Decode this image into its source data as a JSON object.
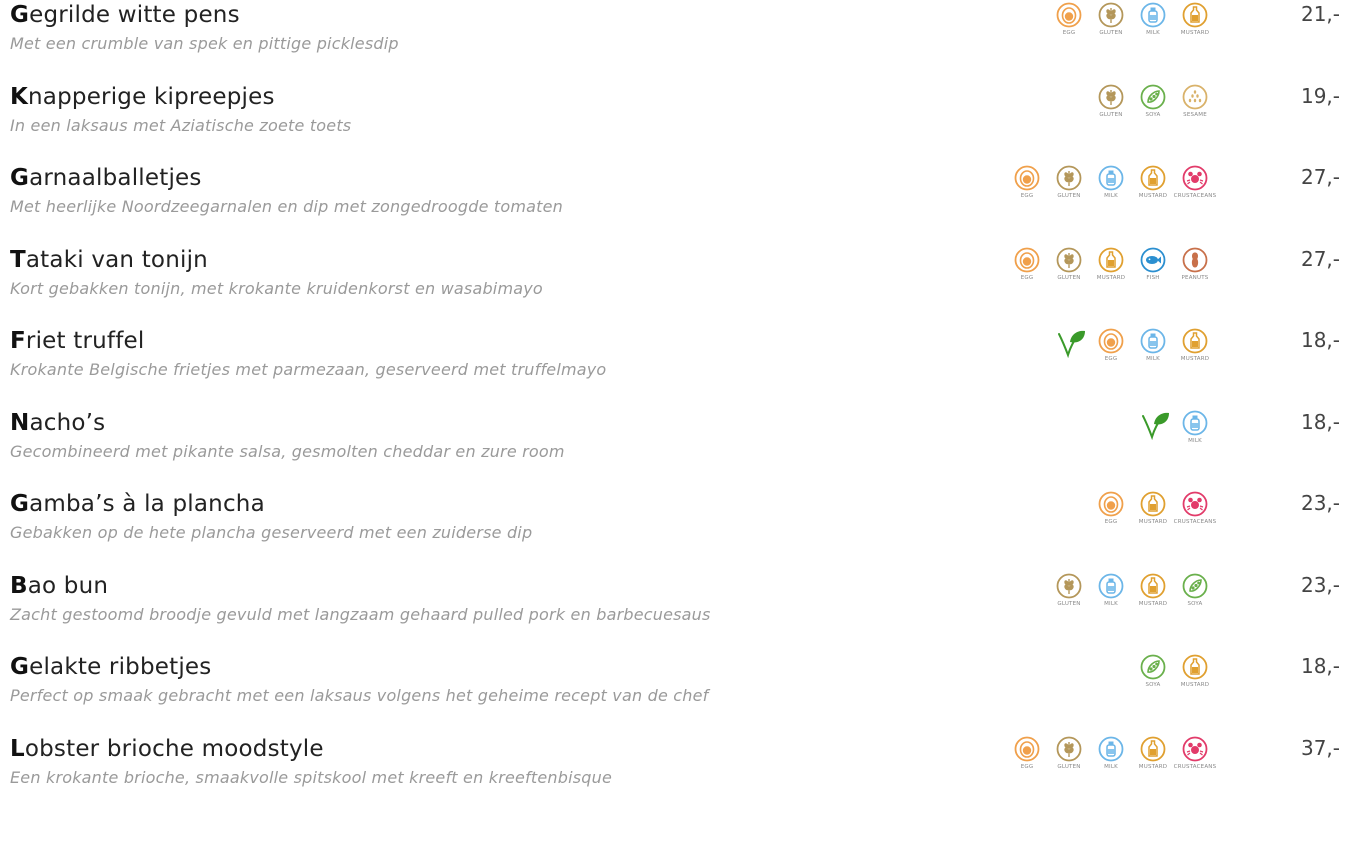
{
  "colors": {
    "egg": "#f0a04b",
    "gluten": "#b4975a",
    "milk": "#6cb6e8",
    "mustard": "#e0a030",
    "crustaceans": "#e23b6a",
    "soya": "#6ab04c",
    "sesame": "#d9b26a",
    "fish": "#2b8fd0",
    "peanuts": "#c8704a",
    "vegetarian": "#3a9a2a"
  },
  "allergen_labels": {
    "egg": "EGG",
    "gluten": "GLUTEN",
    "milk": "MILK",
    "mustard": "MUSTARD",
    "crustaceans": "CRUSTACEANS",
    "soya": "SOYA",
    "sesame": "SESAME",
    "fish": "FISH",
    "peanuts": "PEANUTS"
  },
  "menu": [
    {
      "initial": "G",
      "rest": "egrilde witte pens",
      "description": "Met een crumble van spek en pittige picklesdip",
      "price": "21,-",
      "vegetarian": false,
      "allergens": [
        "egg",
        "gluten",
        "milk",
        "mustard"
      ]
    },
    {
      "initial": "K",
      "rest": "napperige kipreepjes",
      "description": "In een laksaus met Aziatische zoete toets",
      "price": "19,-",
      "vegetarian": false,
      "allergens": [
        "gluten",
        "soya",
        "sesame"
      ]
    },
    {
      "initial": "G",
      "rest": "arnaalballetjes",
      "description": "Met heerlijke Noordzeegarnalen en dip met zongedroogde tomaten",
      "price": "27,-",
      "vegetarian": false,
      "allergens": [
        "egg",
        "gluten",
        "milk",
        "mustard",
        "crustaceans"
      ]
    },
    {
      "initial": "T",
      "rest": "ataki van tonijn",
      "description": "Kort gebakken tonijn, met krokante kruidenkorst en wasabimayo",
      "price": "27,-",
      "vegetarian": false,
      "allergens": [
        "egg",
        "gluten",
        "mustard",
        "fish",
        "peanuts"
      ]
    },
    {
      "initial": "F",
      "rest": "riet truffel",
      "description": "Krokante Belgische frietjes met parmezaan, geserveerd met truffelmayo",
      "price": "18,-",
      "vegetarian": true,
      "allergens": [
        "egg",
        "milk",
        "mustard"
      ]
    },
    {
      "initial": "N",
      "rest": "acho’s",
      "description": "Gecombineerd met pikante salsa, gesmolten cheddar en zure room",
      "price": "18,-",
      "vegetarian": true,
      "allergens": [
        "milk"
      ]
    },
    {
      "initial": "G",
      "rest": "amba’s à la plancha",
      "description": "Gebakken op de hete plancha geserveerd met een zuiderse dip",
      "price": "23,-",
      "vegetarian": false,
      "allergens": [
        "egg",
        "mustard",
        "crustaceans"
      ]
    },
    {
      "initial": "B",
      "rest": "ao bun",
      "description": "Zacht gestoomd broodje gevuld met langzaam gehaard pulled pork en barbecuesaus",
      "price": "23,-",
      "vegetarian": false,
      "allergens": [
        "gluten",
        "milk",
        "mustard",
        "soya"
      ]
    },
    {
      "initial": "G",
      "rest": "elakte ribbetjes",
      "description": "Perfect op smaak gebracht met een laksaus volgens het geheime recept van de chef",
      "price": "18,-",
      "vegetarian": false,
      "allergens": [
        "soya",
        "mustard"
      ]
    },
    {
      "initial": "L",
      "rest": "obster brioche moodstyle",
      "description": "Een krokante brioche, smaakvolle spitskool met kreeft en kreeftenbisque",
      "price": "37,-",
      "vegetarian": false,
      "allergens": [
        "egg",
        "gluten",
        "milk",
        "mustard",
        "crustaceans"
      ]
    }
  ]
}
